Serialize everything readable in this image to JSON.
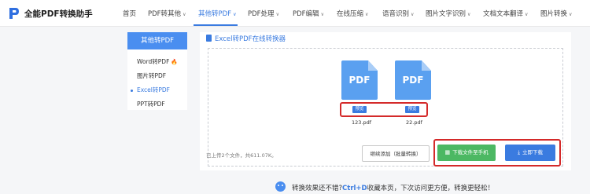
{
  "brand": {
    "name": "全能PDF转换助手"
  },
  "nav": [
    {
      "label": "首页",
      "has_menu": false
    },
    {
      "label": "PDF转其他",
      "has_menu": true
    },
    {
      "label": "其他转PDF",
      "has_menu": true,
      "active": true
    },
    {
      "label": "PDF处理",
      "has_menu": true
    },
    {
      "label": "PDF编辑",
      "has_menu": true
    },
    {
      "label": "在线压缩",
      "has_menu": true
    },
    {
      "label": "语音识别",
      "has_menu": true
    },
    {
      "label": "图片文字识别",
      "has_menu": true
    },
    {
      "label": "文档文本翻译",
      "has_menu": true
    },
    {
      "label": "图片转换",
      "has_menu": true
    }
  ],
  "sidebar": {
    "header": "其他转PDF",
    "items": [
      {
        "label": "Word转PDF",
        "hot": true
      },
      {
        "label": "图片转PDF"
      },
      {
        "label": "Excel转PDF",
        "active": true
      },
      {
        "label": "PPT转PDF"
      }
    ]
  },
  "main": {
    "title": "Excel转PDF在线转换器",
    "files": [
      {
        "icon_text": "PDF",
        "preview_label": "预览",
        "name": "123.pdf"
      },
      {
        "icon_text": "PDF",
        "preview_label": "预览",
        "name": "22.pdf"
      }
    ],
    "summary": "已上传2个文件，共611.07K。",
    "buttons": {
      "continue": "继续添加（批量转换）",
      "mobile": "下载文件至手机",
      "download": "立即下载"
    }
  },
  "footer": {
    "prefix": "转换效果还不错?",
    "shortcut": "Ctrl+D",
    "suffix": "收藏本页，下次访问更方便，转换更轻松！"
  },
  "colors": {
    "accent": "#3a7be0",
    "green": "#4cb863",
    "highlight_red": "#d42a2a"
  }
}
